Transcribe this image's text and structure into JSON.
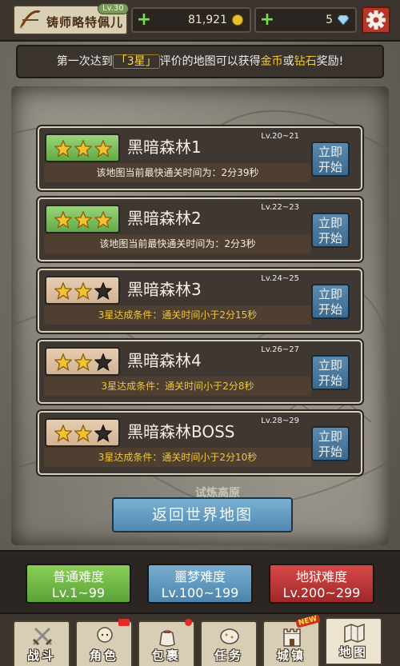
{
  "player": {
    "level_badge": "Lv.30",
    "name": "铸师略特佩儿"
  },
  "resources": {
    "plus": "+",
    "gold": "81,921",
    "gems": "5"
  },
  "notice": {
    "part1": "第一次达到",
    "stars": "「3星」",
    "part2": "评价的地图可以获得",
    "gold": "金币",
    "or": "或",
    "diamond": "钻石",
    "part3": "奖励!"
  },
  "map_labels": [
    "试炼高原"
  ],
  "stages": [
    {
      "name": "黑暗森林1",
      "lv": "Lv.20~21",
      "stars": 3,
      "sub": "该地图当前最快通关时间为：2分39秒",
      "sub_type": "info",
      "button": "立即\n开始"
    },
    {
      "name": "黑暗森林2",
      "lv": "Lv.22~23",
      "stars": 3,
      "sub": "该地图当前最快通关时间为：2分3秒",
      "sub_type": "info",
      "button": "立即\n开始"
    },
    {
      "name": "黑暗森林3",
      "lv": "Lv.24~25",
      "stars": 2,
      "sub": "3星达成条件：通关时间小于2分15秒",
      "sub_type": "cond",
      "button": "立即\n开始"
    },
    {
      "name": "黑暗森林4",
      "lv": "Lv.26~27",
      "stars": 2,
      "sub": "3星达成条件：通关时间小于2分8秒",
      "sub_type": "cond",
      "button": "立即\n开始"
    },
    {
      "name": "黑暗森林BOSS",
      "lv": "Lv.28~29",
      "stars": 2,
      "sub": "3星达成条件：通关时间小于2分10秒",
      "sub_type": "cond",
      "button": "立即\n开始"
    }
  ],
  "return_button": "返回世界地图",
  "difficulty": [
    {
      "name": "普通难度",
      "range": "Lv.1~99"
    },
    {
      "name": "噩梦难度",
      "range": "Lv.100~199"
    },
    {
      "name": "地狱难度",
      "range": "Lv.200~299"
    }
  ],
  "nav": [
    {
      "label": "战斗",
      "icon": "swords-icon"
    },
    {
      "label": "角色",
      "icon": "character-icon"
    },
    {
      "label": "包裹",
      "icon": "bag-icon"
    },
    {
      "label": "任务",
      "icon": "quest-icon"
    },
    {
      "label": "城镇",
      "icon": "town-icon"
    },
    {
      "label": "地图",
      "icon": "map-icon"
    }
  ],
  "nav_new_tag": "NEW",
  "colors": {
    "gold": "#f0c63c",
    "green": "#62aa46",
    "blue": "#4a84ac",
    "red": "#a02828"
  }
}
